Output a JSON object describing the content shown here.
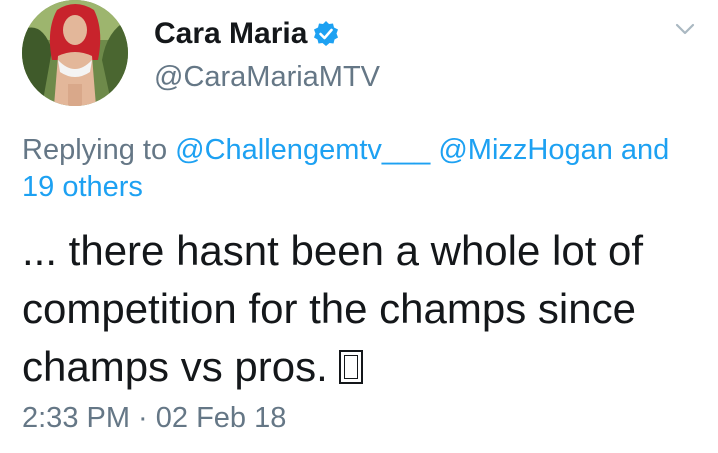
{
  "tweet": {
    "author": {
      "display_name": "Cara Maria",
      "handle": "@CaraMariaMTV",
      "verified": true
    },
    "reply": {
      "prefix": "Replying to ",
      "mention_1": "@Challengemtv___",
      "mention_2": "@MizzHogan",
      "connector": "and",
      "others": "19 others"
    },
    "text_lines": [
      "... there hasnt been a whole lot of",
      "competition for the champs since",
      "champs vs pros. "
    ],
    "timestamp": "2:33 PM · 02 Feb 18"
  },
  "colors": {
    "link": "#1da1f2",
    "muted": "#657786",
    "text": "#14171a"
  },
  "icons": {
    "verified": "verified-badge-icon",
    "caret": "chevron-down-icon",
    "emoji": "missing-glyph-box"
  }
}
